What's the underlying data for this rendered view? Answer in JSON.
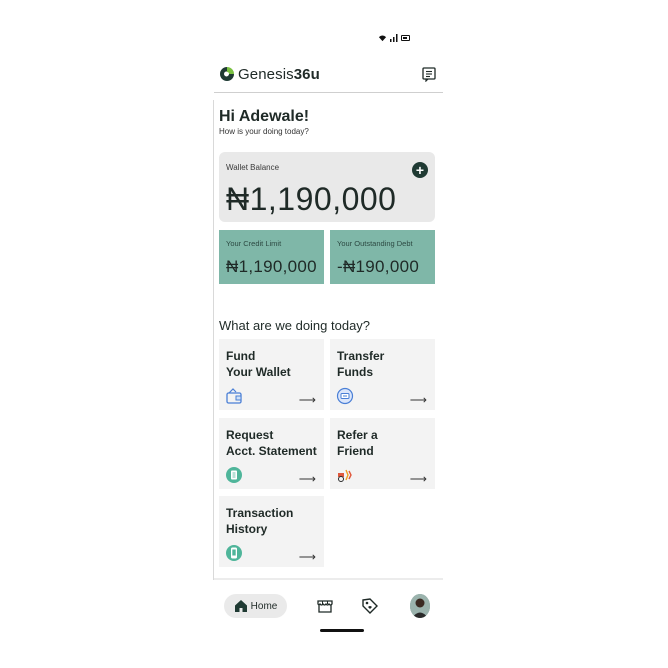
{
  "app": {
    "brand_prefix": "Genesis",
    "brand_suffix": "36u"
  },
  "greeting": {
    "title": "Hi Adewale!",
    "subtitle": "How is your doing today?"
  },
  "wallet": {
    "label": "Wallet Balance",
    "amount": "₦1,190,000"
  },
  "credit_limit": {
    "label": "Your Credit Limit",
    "amount": "₦1,190,000"
  },
  "outstanding_debt": {
    "label": "Your Outstanding Debt",
    "amount": "-₦190,000"
  },
  "section_title": "What are we doing today?",
  "actions": [
    {
      "label": "Fund\nYour Wallet",
      "icon": "wallet-icon"
    },
    {
      "label": "Transfer\nFunds",
      "icon": "transfer-icon"
    },
    {
      "label": "Request\nAcct. Statement",
      "icon": "statement-icon"
    },
    {
      "label": "Refer a\nFriend",
      "icon": "refer-icon"
    },
    {
      "label": "Transaction\nHistory",
      "icon": "history-icon"
    }
  ],
  "arrow": "⟶",
  "tabbar": {
    "home_label": "Home"
  },
  "colors": {
    "accent": "#7fb7a8",
    "dark": "#1f3a33",
    "card": "#e9e9e9",
    "tile": "#f3f3f3"
  }
}
